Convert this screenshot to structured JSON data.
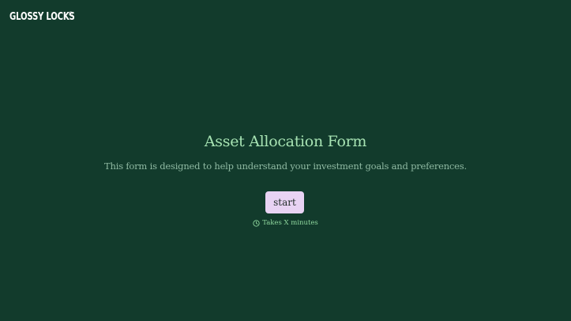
{
  "brand": {
    "name": "GLOSSY LOCKS",
    "mark": "©"
  },
  "form": {
    "title": "Asset Allocation Form",
    "description": "This form is designed to help understand your investment goals and preferences.",
    "start_label": "start",
    "time_note": "Takes X minutes",
    "time_icon": "clock-icon"
  },
  "colors": {
    "background": "#123b2c",
    "title": "#a7e3b3",
    "description": "#8fb9a2",
    "button_bg": "#e8d3f3",
    "note": "#8fd79e"
  }
}
